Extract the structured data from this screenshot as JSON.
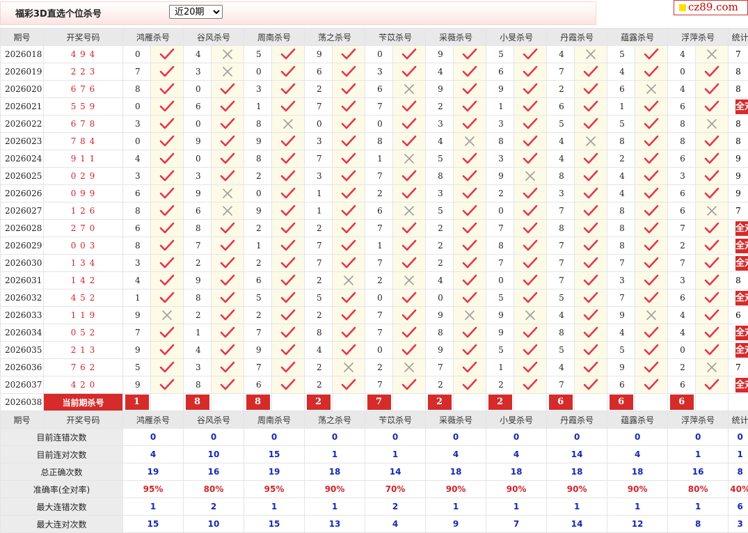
{
  "header": {
    "title": "福彩3D直选个位杀号",
    "period_select": "近20期",
    "site_logo": "cz89.com"
  },
  "columns": {
    "issue": "期号",
    "draw": "开奖号码",
    "experts": [
      "鸿雁杀号",
      "谷风杀号",
      "周南杀号",
      "荡之杀号",
      "苄苡杀号",
      "采薇杀号",
      "小旻杀号",
      "丹霞杀号",
      "蕴露杀号",
      "浮萍杀号"
    ],
    "stats": "统计"
  },
  "rows": [
    {
      "issue": "2026018",
      "draw": "4 9 4",
      "kills": [
        "0",
        "4",
        "5",
        "9",
        "0",
        "9",
        "5",
        "4",
        "5",
        "4"
      ],
      "ok": [
        1,
        0,
        1,
        1,
        1,
        1,
        1,
        0,
        1,
        0
      ],
      "stat": "7"
    },
    {
      "issue": "2026019",
      "draw": "2 2 3",
      "kills": [
        "7",
        "3",
        "0",
        "6",
        "3",
        "4",
        "6",
        "7",
        "4",
        "0"
      ],
      "ok": [
        1,
        0,
        1,
        1,
        1,
        1,
        1,
        1,
        1,
        1
      ],
      "stat": "8"
    },
    {
      "issue": "2026020",
      "draw": "6 7 6",
      "kills": [
        "8",
        "0",
        "3",
        "2",
        "6",
        "9",
        "9",
        "2",
        "6",
        "4"
      ],
      "ok": [
        1,
        1,
        1,
        1,
        0,
        1,
        1,
        1,
        0,
        1
      ],
      "stat": "8"
    },
    {
      "issue": "2026021",
      "draw": "5 5 9",
      "kills": [
        "0",
        "6",
        "1",
        "7",
        "7",
        "2",
        "1",
        "6",
        "1",
        "6"
      ],
      "ok": [
        1,
        1,
        1,
        1,
        1,
        1,
        1,
        1,
        1,
        1
      ],
      "stat": "全对"
    },
    {
      "issue": "2026022",
      "draw": "6 7 8",
      "kills": [
        "3",
        "0",
        "8",
        "0",
        "0",
        "3",
        "3",
        "5",
        "5",
        "8"
      ],
      "ok": [
        1,
        1,
        0,
        1,
        1,
        1,
        1,
        1,
        1,
        0
      ],
      "stat": "8"
    },
    {
      "issue": "2026023",
      "draw": "7 8 4",
      "kills": [
        "0",
        "9",
        "9",
        "3",
        "8",
        "4",
        "8",
        "4",
        "8",
        "8"
      ],
      "ok": [
        1,
        1,
        1,
        1,
        1,
        0,
        1,
        0,
        1,
        1
      ],
      "stat": "8"
    },
    {
      "issue": "2026024",
      "draw": "9 1 1",
      "kills": [
        "4",
        "0",
        "8",
        "7",
        "1",
        "5",
        "3",
        "4",
        "2",
        "6"
      ],
      "ok": [
        1,
        1,
        1,
        1,
        0,
        1,
        1,
        1,
        1,
        1
      ],
      "stat": "9"
    },
    {
      "issue": "2026025",
      "draw": "0 2 9",
      "kills": [
        "3",
        "3",
        "2",
        "3",
        "7",
        "8",
        "9",
        "8",
        "4",
        "3"
      ],
      "ok": [
        1,
        1,
        1,
        1,
        1,
        1,
        0,
        1,
        1,
        1
      ],
      "stat": "9"
    },
    {
      "issue": "2026026",
      "draw": "0 9 9",
      "kills": [
        "6",
        "9",
        "0",
        "1",
        "2",
        "3",
        "2",
        "3",
        "4",
        "6"
      ],
      "ok": [
        1,
        0,
        1,
        1,
        1,
        1,
        1,
        1,
        1,
        1
      ],
      "stat": "9"
    },
    {
      "issue": "2026027",
      "draw": "1 2 6",
      "kills": [
        "8",
        "6",
        "9",
        "1",
        "6",
        "5",
        "0",
        "7",
        "8",
        "6"
      ],
      "ok": [
        1,
        0,
        1,
        1,
        0,
        1,
        1,
        1,
        1,
        0
      ],
      "stat": "7"
    },
    {
      "issue": "2026028",
      "draw": "2 7 0",
      "kills": [
        "6",
        "8",
        "2",
        "2",
        "7",
        "2",
        "7",
        "8",
        "8",
        "7"
      ],
      "ok": [
        1,
        1,
        1,
        1,
        1,
        1,
        1,
        1,
        1,
        1
      ],
      "stat": "全对"
    },
    {
      "issue": "2026029",
      "draw": "0 0 3",
      "kills": [
        "8",
        "7",
        "1",
        "7",
        "1",
        "2",
        "8",
        "7",
        "8",
        "2"
      ],
      "ok": [
        1,
        1,
        1,
        1,
        1,
        1,
        1,
        1,
        1,
        1
      ],
      "stat": "全对"
    },
    {
      "issue": "2026030",
      "draw": "1 3 4",
      "kills": [
        "3",
        "2",
        "2",
        "7",
        "7",
        "2",
        "7",
        "7",
        "7",
        "7"
      ],
      "ok": [
        1,
        1,
        1,
        1,
        1,
        1,
        1,
        1,
        1,
        1
      ],
      "stat": "全对"
    },
    {
      "issue": "2026031",
      "draw": "1 4 2",
      "kills": [
        "4",
        "9",
        "6",
        "2",
        "2",
        "4",
        "0",
        "7",
        "3",
        "3"
      ],
      "ok": [
        1,
        1,
        1,
        0,
        0,
        1,
        1,
        1,
        1,
        1
      ],
      "stat": "8"
    },
    {
      "issue": "2026032",
      "draw": "4 5 2",
      "kills": [
        "1",
        "8",
        "5",
        "5",
        "0",
        "0",
        "5",
        "5",
        "7",
        "6"
      ],
      "ok": [
        1,
        1,
        1,
        1,
        1,
        1,
        1,
        1,
        1,
        1
      ],
      "stat": "全对"
    },
    {
      "issue": "2026033",
      "draw": "1 1 9",
      "kills": [
        "9",
        "2",
        "2",
        "2",
        "7",
        "9",
        "9",
        "4",
        "9",
        "4"
      ],
      "ok": [
        0,
        1,
        1,
        1,
        1,
        0,
        0,
        1,
        0,
        1
      ],
      "stat": "6"
    },
    {
      "issue": "2026034",
      "draw": "0 5 2",
      "kills": [
        "7",
        "1",
        "7",
        "8",
        "7",
        "8",
        "9",
        "8",
        "4",
        "4"
      ],
      "ok": [
        1,
        1,
        1,
        1,
        1,
        1,
        1,
        1,
        1,
        1
      ],
      "stat": "全对"
    },
    {
      "issue": "2026035",
      "draw": "2 1 3",
      "kills": [
        "9",
        "4",
        "9",
        "4",
        "0",
        "9",
        "5",
        "5",
        "5",
        "0"
      ],
      "ok": [
        1,
        1,
        1,
        1,
        1,
        1,
        1,
        1,
        1,
        1
      ],
      "stat": "全对"
    },
    {
      "issue": "2026036",
      "draw": "7 6 2",
      "kills": [
        "5",
        "3",
        "7",
        "2",
        "2",
        "7",
        "1",
        "4",
        "9",
        "2"
      ],
      "ok": [
        1,
        1,
        1,
        0,
        0,
        1,
        1,
        1,
        1,
        0
      ],
      "stat": "7"
    },
    {
      "issue": "2026037",
      "draw": "4 2 0",
      "kills": [
        "9",
        "8",
        "6",
        "2",
        "7",
        "2",
        "2",
        "7",
        "6",
        "6"
      ],
      "ok": [
        1,
        1,
        1,
        1,
        1,
        1,
        1,
        1,
        1,
        1
      ],
      "stat": "全对"
    }
  ],
  "current": {
    "issue": "2026038",
    "label": "当前期杀号",
    "picks": [
      "1",
      "8",
      "8",
      "2",
      "7",
      "2",
      "2",
      "6",
      "6",
      "6"
    ]
  },
  "summary": {
    "header_issue": "期号",
    "header_draw": "开奖号码",
    "rows": [
      {
        "label": "目前连错次数",
        "values": [
          "0",
          "0",
          "0",
          "0",
          "0",
          "0",
          "0",
          "0",
          "0",
          "0"
        ],
        "stat": "0",
        "red": false
      },
      {
        "label": "目前连对次数",
        "values": [
          "4",
          "10",
          "15",
          "1",
          "1",
          "4",
          "4",
          "14",
          "4",
          "1"
        ],
        "stat": "1",
        "red": false
      },
      {
        "label": "总正确次数",
        "values": [
          "19",
          "16",
          "19",
          "18",
          "14",
          "18",
          "18",
          "18",
          "18",
          "16"
        ],
        "stat": "8",
        "red": false
      },
      {
        "label": "准确率(全对率)",
        "values": [
          "95%",
          "80%",
          "95%",
          "90%",
          "70%",
          "90%",
          "90%",
          "90%",
          "90%",
          "80%"
        ],
        "stat": "40%",
        "red": true
      },
      {
        "label": "最大连错次数",
        "values": [
          "1",
          "2",
          "1",
          "1",
          "2",
          "1",
          "1",
          "1",
          "1",
          "1"
        ],
        "stat": "6",
        "red": false
      },
      {
        "label": "最大连对次数",
        "values": [
          "15",
          "10",
          "15",
          "13",
          "4",
          "9",
          "7",
          "14",
          "12",
          "8"
        ],
        "stat": "3",
        "red": false
      }
    ]
  },
  "colors": {
    "accent": "#d52b2b",
    "value_blue": "#1428b8",
    "check": "#e8334a",
    "cross": "#a0a0a0"
  }
}
